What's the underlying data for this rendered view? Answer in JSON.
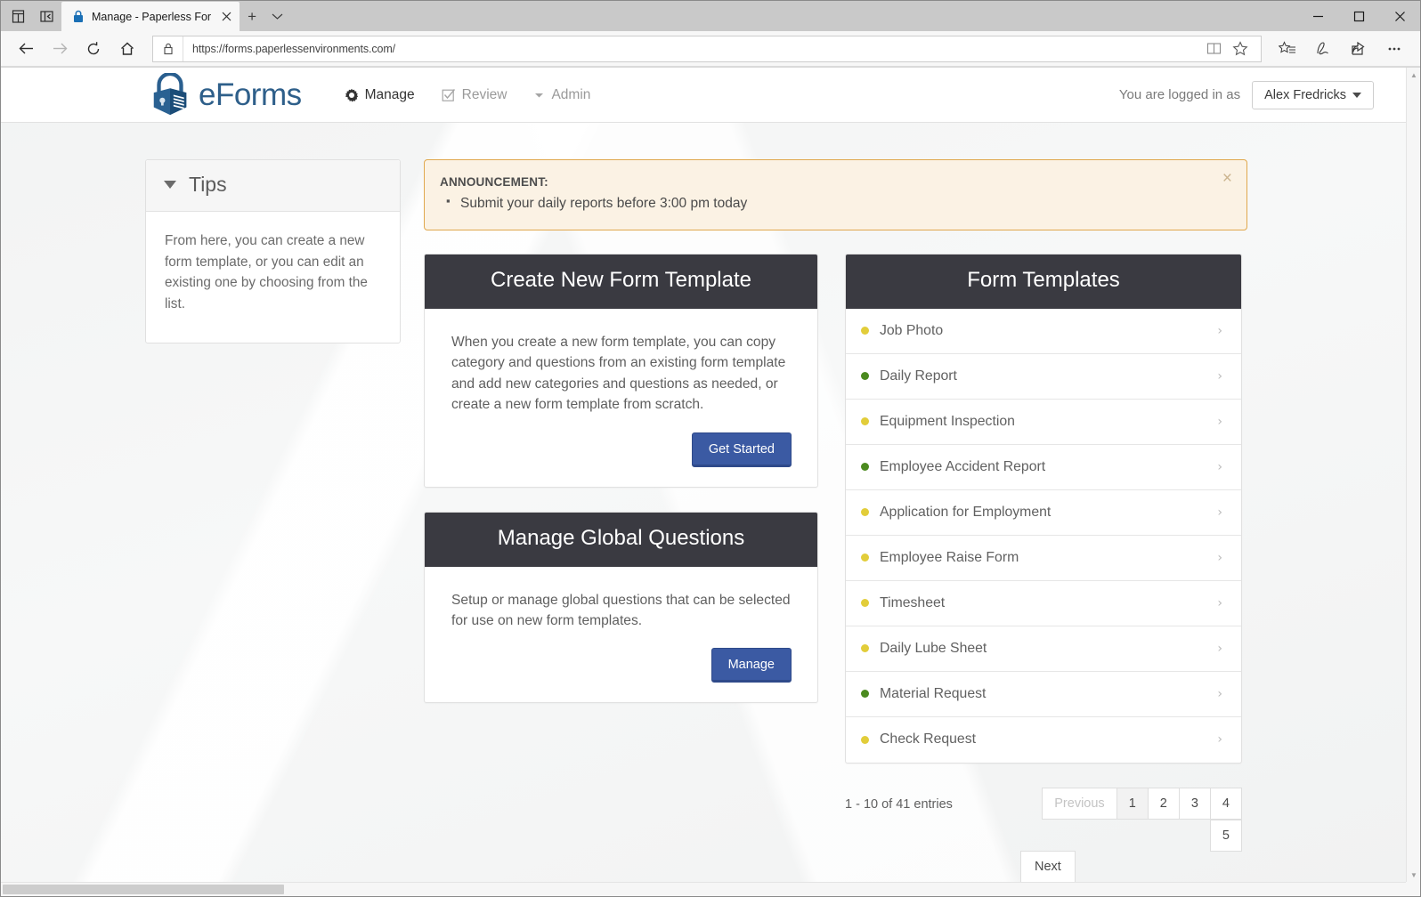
{
  "browser": {
    "tab": {
      "title": "Manage - Paperless For",
      "lock_icon": "lock-icon",
      "close_icon": "close-icon"
    },
    "new_tab_label": "+",
    "tab_list_icon": "chevron-down-icon",
    "window_controls": {
      "minimize": "minimize-icon",
      "maximize": "maximize-icon",
      "close": "close-icon"
    },
    "toolbar": {
      "back": "back-arrow-icon",
      "forward": "forward-arrow-icon",
      "refresh": "refresh-icon",
      "home": "home-icon",
      "url": "https://forms.paperlessenvironments.com/",
      "url_lock": "lock-icon",
      "reading_view": "book-icon",
      "favorite": "star-icon",
      "favorites_hub": "favorites-list-icon",
      "web_notes": "pen-icon",
      "share": "share-icon",
      "more": "ellipsis-icon"
    }
  },
  "header": {
    "brand_name": "eForms",
    "brand_color": "#2e5f8a",
    "nav": [
      {
        "label": "Manage",
        "icon": "gear-icon",
        "active": true
      },
      {
        "label": "Review",
        "icon": "checkbox-icon",
        "active": false
      },
      {
        "label": "Admin",
        "icon": "caret-down-icon",
        "active": false
      }
    ],
    "logged_in_label": "You are logged in as",
    "user_name": "Alex Fredricks"
  },
  "tips": {
    "title": "Tips",
    "body": "From here, you can create a new form template, or you can edit an existing one by choosing from the list."
  },
  "announcement": {
    "title": "ANNOUNCEMENT:",
    "items": [
      "Submit your daily reports before 3:00 pm today"
    ],
    "close_label": "×",
    "border_color": "#e0a84e",
    "background_color": "#fbf2e4"
  },
  "create_card": {
    "title": "Create New Form Template",
    "text": "When you create a new form template, you can copy category and questions from an existing form template and add new categories and questions as needed, or create a new form template from scratch.",
    "button": "Get Started"
  },
  "global_card": {
    "title": "Manage Global Questions",
    "text": "Setup or manage global questions that can be selected for use on new form templates.",
    "button": "Manage"
  },
  "templates": {
    "title": "Form Templates",
    "colors": {
      "yellow": "#e2cd3a",
      "green": "#4b8a1f"
    },
    "items": [
      {
        "label": "Job Photo",
        "status": "yellow"
      },
      {
        "label": "Daily Report",
        "status": "green"
      },
      {
        "label": "Equipment Inspection",
        "status": "yellow"
      },
      {
        "label": "Employee Accident Report",
        "status": "green"
      },
      {
        "label": "Application for Employment",
        "status": "yellow"
      },
      {
        "label": "Employee Raise Form",
        "status": "yellow"
      },
      {
        "label": "Timesheet",
        "status": "yellow"
      },
      {
        "label": "Daily Lube Sheet",
        "status": "yellow"
      },
      {
        "label": "Material Request",
        "status": "green"
      },
      {
        "label": "Check Request",
        "status": "yellow"
      }
    ],
    "chevron": "›"
  },
  "pagination": {
    "info": "1 - 10 of 41 entries",
    "previous": "Previous",
    "next": "Next",
    "pages": [
      "1",
      "2",
      "3",
      "4",
      "5"
    ],
    "active_page": "1"
  }
}
